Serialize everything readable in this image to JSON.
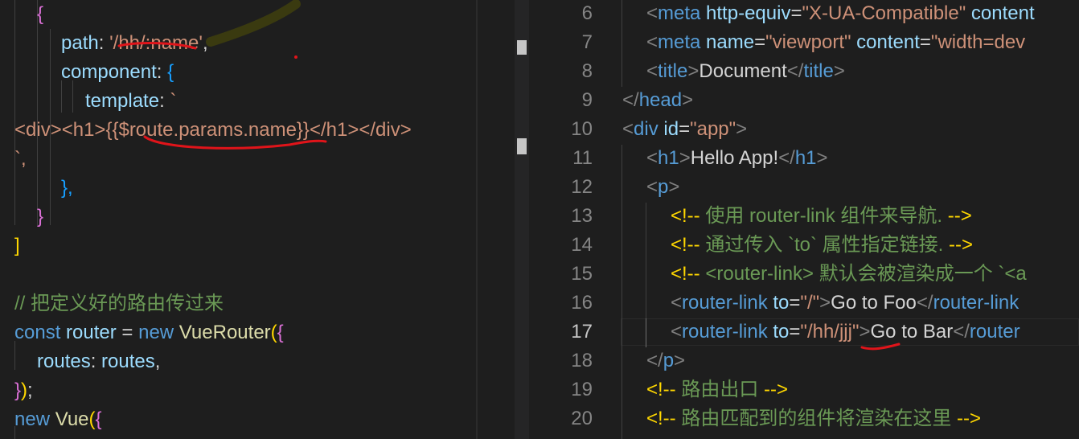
{
  "left_editor": {
    "lines": [
      {
        "text": "{",
        "cls": "m"
      },
      {
        "parts": [
          {
            "t": "path",
            "c": "a"
          },
          {
            "t": ": ",
            "c": "w"
          },
          {
            "t": "'/hh/:name'",
            "c": "s"
          },
          {
            "t": ",",
            "c": "w"
          }
        ]
      },
      {
        "parts": [
          {
            "t": "component",
            "c": "a"
          },
          {
            "t": ": ",
            "c": "w"
          },
          {
            "t": "{",
            "c": "b"
          }
        ]
      },
      {
        "parts": [
          {
            "t": "template",
            "c": "a"
          },
          {
            "t": ": ",
            "c": "w"
          },
          {
            "t": "`",
            "c": "s"
          }
        ]
      },
      {
        "parts": [
          {
            "t": "<div><h1>{{$route.params.name}}</h1></div>",
            "c": "s"
          }
        ]
      },
      {
        "parts": [
          {
            "t": "`,",
            "c": "s"
          }
        ]
      },
      {
        "parts": [
          {
            "t": "},",
            "c": "b"
          }
        ]
      },
      {
        "parts": [
          {
            "t": "}",
            "c": "m"
          }
        ]
      },
      {
        "parts": [
          {
            "t": "]",
            "c": "y"
          }
        ]
      },
      {
        "parts": [
          {
            "t": "",
            "c": "w"
          }
        ]
      },
      {
        "parts": [
          {
            "t": "// 把定义好的路由传过来",
            "c": "c"
          }
        ]
      },
      {
        "parts": [
          {
            "t": "const",
            "c": "k"
          },
          {
            "t": " router",
            "c": "a"
          },
          {
            "t": " = ",
            "c": "w"
          },
          {
            "t": "new",
            "c": "k"
          },
          {
            "t": " VueRouter",
            "c": "f"
          },
          {
            "t": "(",
            "c": "y"
          },
          {
            "t": "{",
            "c": "m"
          }
        ]
      },
      {
        "parts": [
          {
            "t": "routes",
            "c": "a"
          },
          {
            "t": ": ",
            "c": "w"
          },
          {
            "t": "routes",
            "c": "a"
          },
          {
            "t": ",",
            "c": "w"
          }
        ]
      },
      {
        "parts": [
          {
            "t": "}",
            "c": "m"
          },
          {
            "t": ")",
            "c": "y"
          },
          {
            "t": ";",
            "c": "w"
          }
        ]
      },
      {
        "parts": [
          {
            "t": "new",
            "c": "k"
          },
          {
            "t": " Vue",
            "c": "f"
          },
          {
            "t": "(",
            "c": "y"
          },
          {
            "t": "{",
            "c": "m"
          }
        ]
      }
    ]
  },
  "right_editor": {
    "lines": [
      {
        "num": "6",
        "parts": [
          {
            "t": "<",
            "c": "p"
          },
          {
            "t": "meta",
            "c": "t"
          },
          {
            "t": " http-equiv",
            "c": "a"
          },
          {
            "t": "=",
            "c": "w"
          },
          {
            "t": "\"X-UA-Compatible\"",
            "c": "s"
          },
          {
            "t": " content",
            "c": "a"
          }
        ]
      },
      {
        "num": "7",
        "parts": [
          {
            "t": "<",
            "c": "p"
          },
          {
            "t": "meta",
            "c": "t"
          },
          {
            "t": " name",
            "c": "a"
          },
          {
            "t": "=",
            "c": "w"
          },
          {
            "t": "\"viewport\"",
            "c": "s"
          },
          {
            "t": " content",
            "c": "a"
          },
          {
            "t": "=",
            "c": "w"
          },
          {
            "t": "\"width=dev",
            "c": "s"
          }
        ]
      },
      {
        "num": "8",
        "parts": [
          {
            "t": "<",
            "c": "p"
          },
          {
            "t": "title",
            "c": "t"
          },
          {
            "t": ">",
            "c": "p"
          },
          {
            "t": "Document",
            "c": "w"
          },
          {
            "t": "</",
            "c": "p"
          },
          {
            "t": "title",
            "c": "t"
          },
          {
            "t": ">",
            "c": "p"
          }
        ]
      },
      {
        "num": "9",
        "parts": [
          {
            "t": "</",
            "c": "p"
          },
          {
            "t": "head",
            "c": "t"
          },
          {
            "t": ">",
            "c": "p"
          }
        ]
      },
      {
        "num": "10",
        "parts": [
          {
            "t": "<",
            "c": "p"
          },
          {
            "t": "div",
            "c": "t"
          },
          {
            "t": " id",
            "c": "a"
          },
          {
            "t": "=",
            "c": "w"
          },
          {
            "t": "\"app\"",
            "c": "s"
          },
          {
            "t": ">",
            "c": "p"
          }
        ]
      },
      {
        "num": "11",
        "parts": [
          {
            "t": "<",
            "c": "p"
          },
          {
            "t": "h1",
            "c": "t"
          },
          {
            "t": ">",
            "c": "p"
          },
          {
            "t": "Hello App!",
            "c": "w"
          },
          {
            "t": "</",
            "c": "p"
          },
          {
            "t": "h1",
            "c": "t"
          },
          {
            "t": ">",
            "c": "p"
          }
        ]
      },
      {
        "num": "12",
        "parts": [
          {
            "t": "<",
            "c": "p"
          },
          {
            "t": "p",
            "c": "t"
          },
          {
            "t": ">",
            "c": "p"
          }
        ]
      },
      {
        "num": "13",
        "parts": [
          {
            "t": "<!-- ",
            "c": "y"
          },
          {
            "t": "使用 router-link 组件来导航. ",
            "c": "c"
          },
          {
            "t": "-->",
            "c": "y"
          }
        ]
      },
      {
        "num": "14",
        "parts": [
          {
            "t": "<!-- ",
            "c": "y"
          },
          {
            "t": "通过传入 `to` 属性指定链接. ",
            "c": "c"
          },
          {
            "t": "-->",
            "c": "y"
          }
        ]
      },
      {
        "num": "15",
        "parts": [
          {
            "t": "<!-- ",
            "c": "y"
          },
          {
            "t": "<router-link> 默认会被渲染成一个 `<a",
            "c": "c"
          }
        ]
      },
      {
        "num": "16",
        "parts": [
          {
            "t": "<",
            "c": "p"
          },
          {
            "t": "router-link",
            "c": "t"
          },
          {
            "t": " to",
            "c": "a"
          },
          {
            "t": "=",
            "c": "w"
          },
          {
            "t": "\"/\"",
            "c": "s"
          },
          {
            "t": ">",
            "c": "p"
          },
          {
            "t": "Go to Foo",
            "c": "w"
          },
          {
            "t": "</",
            "c": "p"
          },
          {
            "t": "router-link",
            "c": "t"
          }
        ]
      },
      {
        "num": "17",
        "parts": [
          {
            "t": "<",
            "c": "p"
          },
          {
            "t": "router-link",
            "c": "t"
          },
          {
            "t": " to",
            "c": "a"
          },
          {
            "t": "=",
            "c": "w"
          },
          {
            "t": "\"/hh/jjj\"",
            "c": "s"
          },
          {
            "t": ">",
            "c": "p"
          },
          {
            "t": "Go to Bar",
            "c": "w"
          },
          {
            "t": "</",
            "c": "p"
          },
          {
            "t": "router",
            "c": "t"
          }
        ]
      },
      {
        "num": "18",
        "parts": [
          {
            "t": "</",
            "c": "p"
          },
          {
            "t": "p",
            "c": "t"
          },
          {
            "t": ">",
            "c": "p"
          }
        ]
      },
      {
        "num": "19",
        "parts": [
          {
            "t": "<!-- ",
            "c": "y"
          },
          {
            "t": "路由出口 ",
            "c": "c"
          },
          {
            "t": "-->",
            "c": "y"
          }
        ]
      },
      {
        "num": "20",
        "parts": [
          {
            "t": "<!-- ",
            "c": "y"
          },
          {
            "t": "路由匹配到的组件将渲染在这里 ",
            "c": "c"
          },
          {
            "t": "-->",
            "c": "y"
          }
        ]
      }
    ],
    "active_line": "17"
  },
  "colors": {
    "background": "#1e1e1e",
    "annotation_red": "#e0141a",
    "annotation_yellow_highlight": "#ffff00"
  }
}
